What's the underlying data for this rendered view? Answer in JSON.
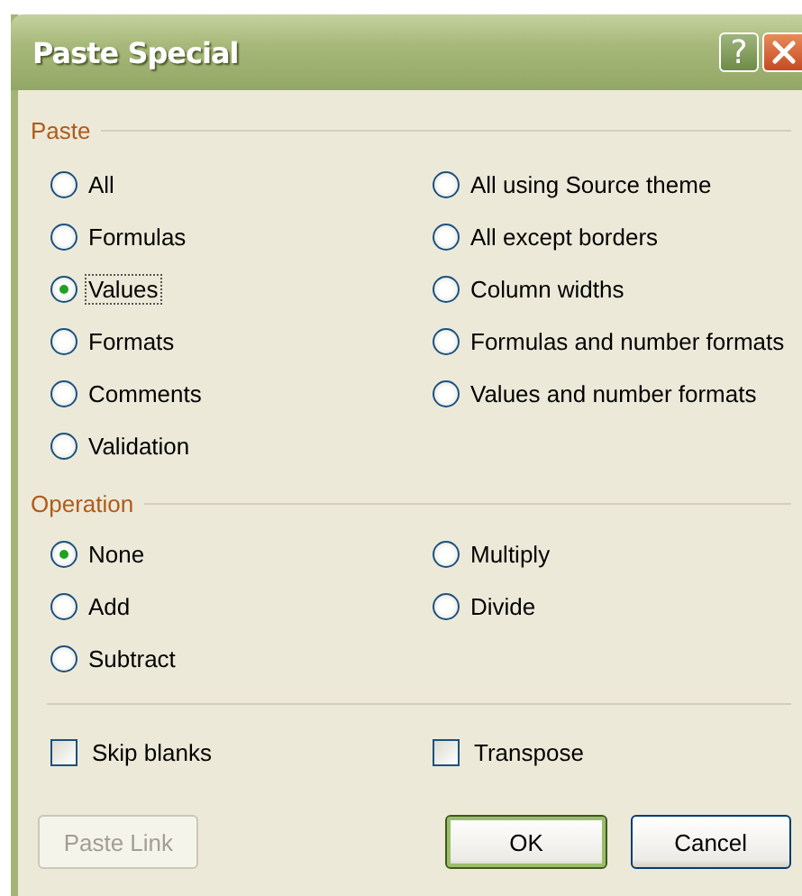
{
  "window": {
    "title": "Paste Special",
    "help": "?"
  },
  "paste": {
    "label": "Paste",
    "options": [
      {
        "label": "All",
        "selected": false
      },
      {
        "label": "Formulas",
        "selected": false
      },
      {
        "label": "Values",
        "selected": true
      },
      {
        "label": "Formats",
        "selected": false
      },
      {
        "label": "Comments",
        "selected": false
      },
      {
        "label": "Validation",
        "selected": false
      },
      {
        "label": "All using Source theme",
        "selected": false
      },
      {
        "label": "All except borders",
        "selected": false
      },
      {
        "label": "Column widths",
        "selected": false
      },
      {
        "label": "Formulas and number formats",
        "selected": false
      },
      {
        "label": "Values and number formats",
        "selected": false
      }
    ]
  },
  "operation": {
    "label": "Operation",
    "options": [
      {
        "label": "None",
        "selected": true
      },
      {
        "label": "Add",
        "selected": false
      },
      {
        "label": "Subtract",
        "selected": false
      },
      {
        "label": "Multiply",
        "selected": false
      },
      {
        "label": "Divide",
        "selected": false
      }
    ]
  },
  "checkboxes": [
    {
      "label": "Skip blanks",
      "checked": false
    },
    {
      "label": "Transpose",
      "checked": false
    }
  ],
  "buttons": [
    {
      "label": "Paste Link",
      "disabled": true,
      "default": false
    },
    {
      "label": "OK",
      "disabled": false,
      "default": true
    },
    {
      "label": "Cancel",
      "disabled": false,
      "default": false
    }
  ]
}
